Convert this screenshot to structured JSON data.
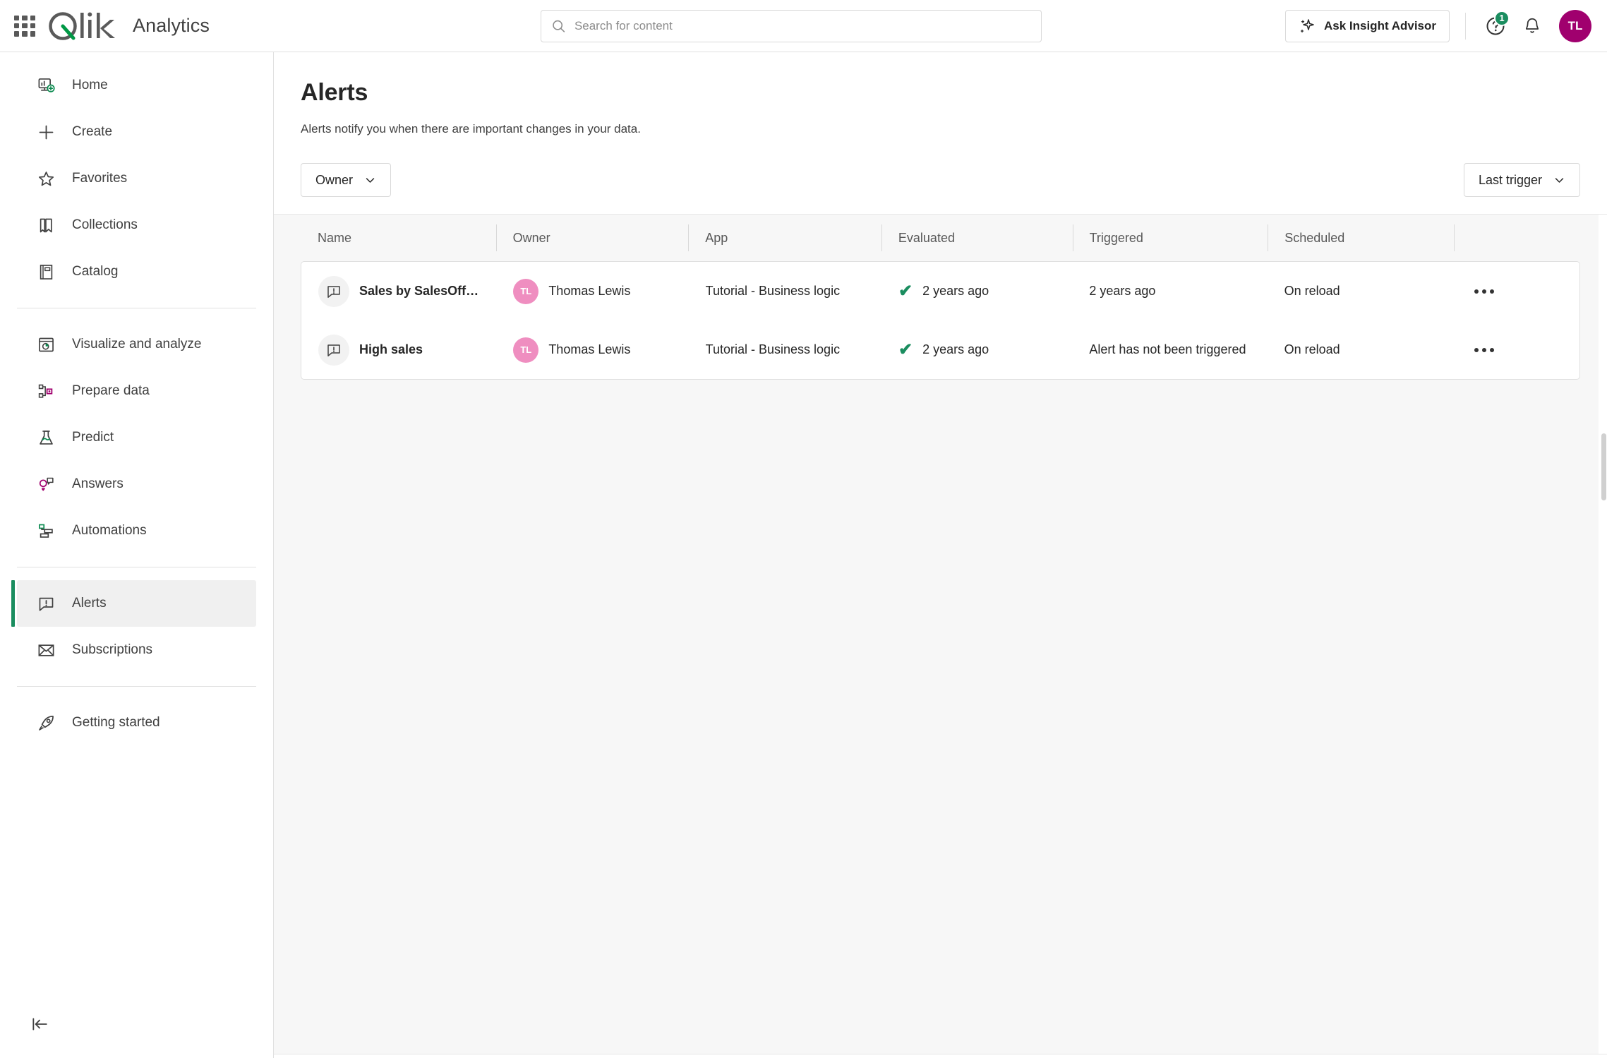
{
  "topbar": {
    "waffle_label": "app-launcher",
    "brand": "Qlik",
    "product": "Analytics",
    "search_placeholder": "Search for content",
    "search_value": "",
    "insight_advisor": "Ask Insight Advisor",
    "help_badge": "1",
    "avatar_initials": "TL"
  },
  "sidebar": {
    "groups": [
      {
        "items": [
          {
            "label": "Home",
            "icon": "home-dashboard-icon",
            "active": false
          },
          {
            "label": "Create",
            "icon": "plus-icon",
            "active": false
          },
          {
            "label": "Favorites",
            "icon": "star-icon",
            "active": false
          },
          {
            "label": "Collections",
            "icon": "bookmark-icon",
            "active": false
          },
          {
            "label": "Catalog",
            "icon": "book-icon",
            "active": false
          }
        ]
      },
      {
        "items": [
          {
            "label": "Visualize and analyze",
            "icon": "chart-window-icon",
            "active": false
          },
          {
            "label": "Prepare data",
            "icon": "data-nodes-icon",
            "active": false
          },
          {
            "label": "Predict",
            "icon": "flask-icon",
            "active": false
          },
          {
            "label": "Answers",
            "icon": "lightbulb-chat-icon",
            "active": false
          },
          {
            "label": "Automations",
            "icon": "automation-blocks-icon",
            "active": false
          }
        ]
      },
      {
        "items": [
          {
            "label": "Alerts",
            "icon": "alert-bubble-icon",
            "active": true
          },
          {
            "label": "Subscriptions",
            "icon": "envelope-icon",
            "active": false
          }
        ]
      },
      {
        "items": [
          {
            "label": "Getting started",
            "icon": "rocket-icon",
            "active": false
          }
        ]
      }
    ],
    "collapse_label": "Collapse navigation"
  },
  "page": {
    "title": "Alerts",
    "subtitle": "Alerts notify you when there are important changes in your data.",
    "owner_filter": "Owner",
    "sort_filter": "Last trigger"
  },
  "table": {
    "columns": [
      "Name",
      "Owner",
      "App",
      "Evaluated",
      "Triggered",
      "Scheduled",
      ""
    ],
    "rows": [
      {
        "name": "Sales by SalesOff…",
        "owner": "Thomas Lewis",
        "owner_initials": "TL",
        "app": "Tutorial - Business logic",
        "evaluated": "2 years ago",
        "evaluated_ok": true,
        "triggered": "2 years ago",
        "scheduled": "On reload"
      },
      {
        "name": "High sales",
        "owner": "Thomas Lewis",
        "owner_initials": "TL",
        "app": "Tutorial - Business logic",
        "evaluated": "2 years ago",
        "evaluated_ok": true,
        "triggered": "Alert has not been triggered",
        "scheduled": "On reload"
      }
    ]
  },
  "colors": {
    "brand_green": "#1a8d5f",
    "avatar_top": "#a0006e",
    "avatar_row": "#ef8ec0",
    "accent_magenta": "#a0006e",
    "text_dark": "#262626"
  }
}
